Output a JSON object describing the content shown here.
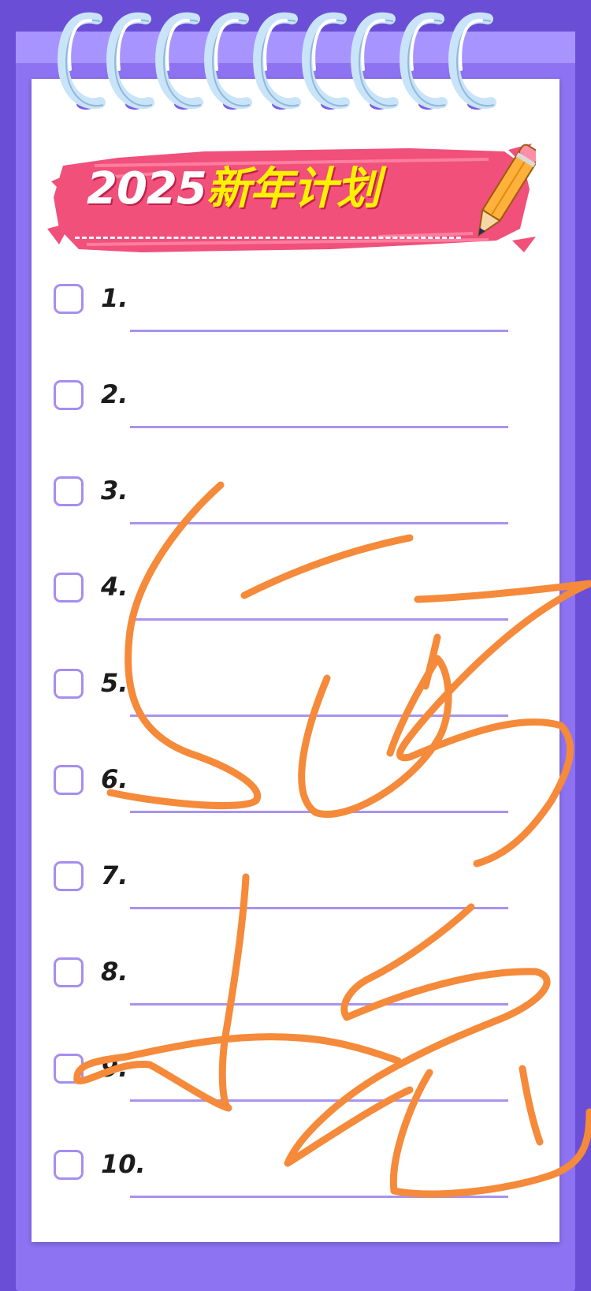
{
  "title": {
    "year": "2025",
    "text": "新年计划"
  },
  "items": [
    {
      "number": "1."
    },
    {
      "number": "2."
    },
    {
      "number": "3."
    },
    {
      "number": "4."
    },
    {
      "number": "5."
    },
    {
      "number": "6."
    },
    {
      "number": "7."
    },
    {
      "number": "8."
    },
    {
      "number": "9."
    },
    {
      "number": "10."
    }
  ],
  "colors": {
    "background": "#6a4fd6",
    "paper": "#ffffff",
    "banner": "#f0507a",
    "title_accent": "#fff200",
    "rule_line": "#a893ef",
    "checkbox": "#a58ef0",
    "scribble": "#f58a3a"
  },
  "icons": [
    "spiral-ring-icon",
    "pencil-icon",
    "checkbox-icon"
  ]
}
